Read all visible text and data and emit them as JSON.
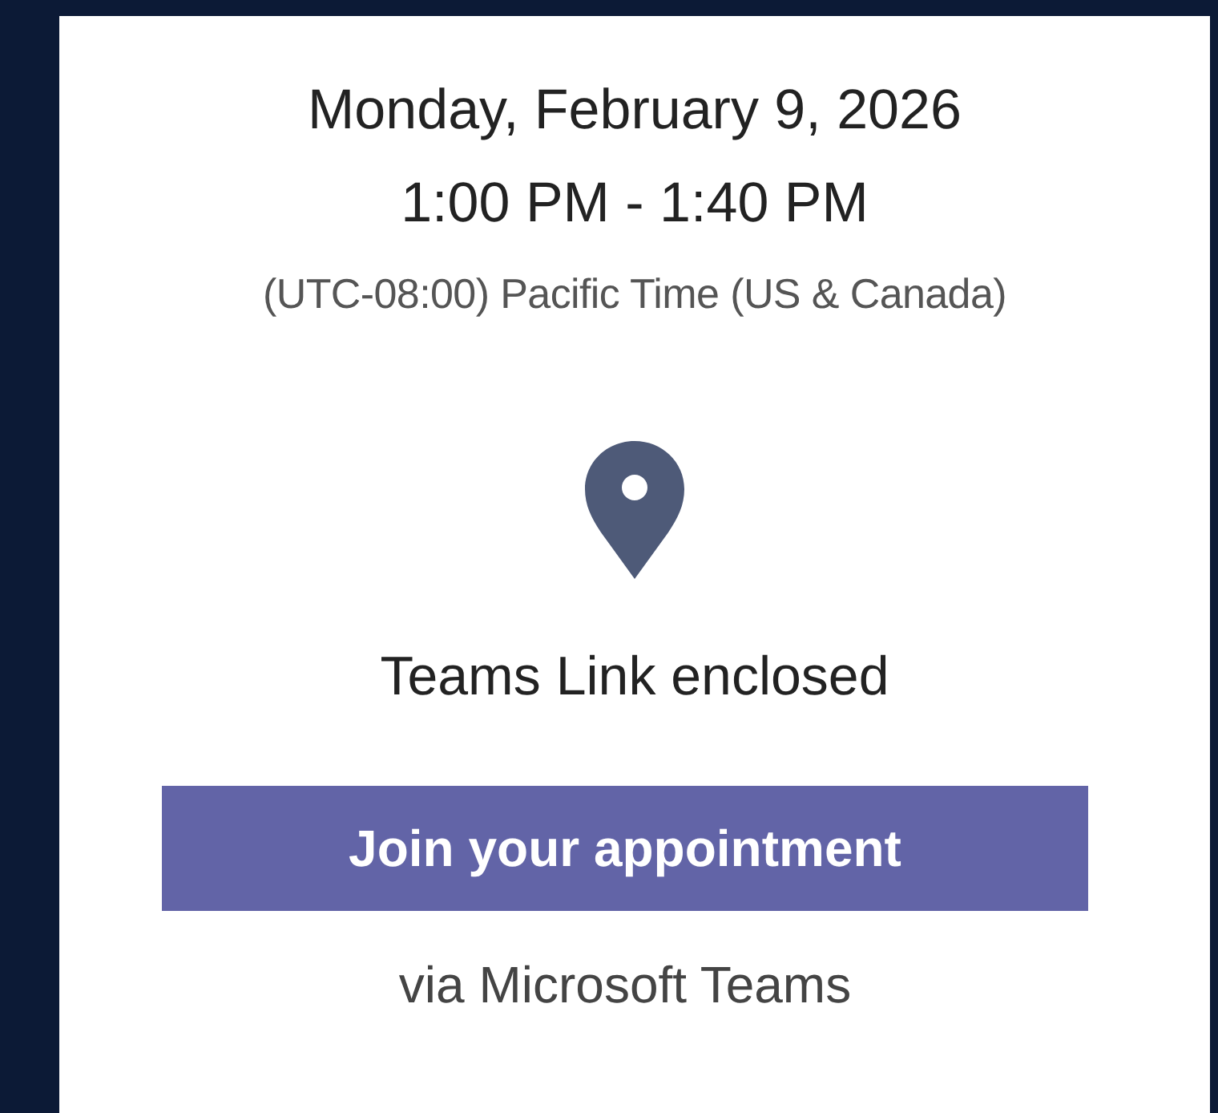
{
  "event": {
    "date": "Monday, February 9, 2026",
    "time": "1:00 PM - 1:40 PM",
    "timezone": "(UTC-08:00) Pacific Time (US & Canada)"
  },
  "location": {
    "text": "Teams Link enclosed"
  },
  "join": {
    "button": "Join your appointment",
    "note": "via Microsoft Teams"
  }
}
